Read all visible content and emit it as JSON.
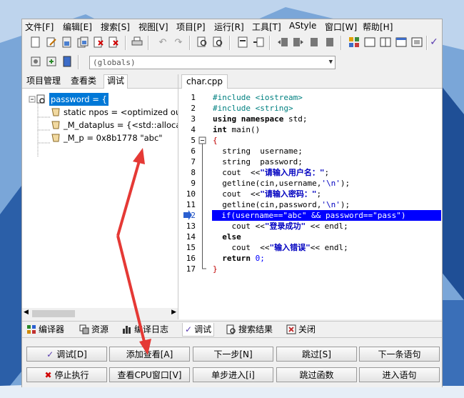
{
  "menubar": [
    "文件[F]",
    "编辑[E]",
    "搜索[S]",
    "视图[V]",
    "项目[P]",
    "运行[R]",
    "工具[T]",
    "AStyle",
    "窗口[W]",
    "帮助[H]"
  ],
  "globals_combo": "(globals)",
  "left_tabs": [
    "项目管理",
    "查看类",
    "调试"
  ],
  "watch_tree": [
    "password = {",
    "static npos = <optimized out",
    "_M_dataplus = {<std::allocat",
    "_M_p = 0x8b1778 \"abc\""
  ],
  "editor_tab": "char.cpp",
  "line_numbers": [
    "1",
    "2",
    "3",
    "4",
    "5",
    "6",
    "7",
    "8",
    "9",
    "10",
    "11",
    "12",
    "13",
    "14",
    "15",
    "16",
    "17"
  ],
  "code": {
    "l1a": "#include ",
    "l1b": "<iostream>",
    "l2a": "#include ",
    "l2b": "<string>",
    "l3a": "using namespace",
    "l3b": " std;",
    "l4a": "int",
    "l4b": " main()",
    "l5": "{",
    "l6": "  string  username;",
    "l7": "  string  password;",
    "l8a": "  cout  <<",
    "l8b": "\"请输入用户名：\"",
    "l8c": ";",
    "l9a": "  getline(cin,username,",
    "l9b": "'\\n'",
    "l9c": ");",
    "l10a": "  cout  <<",
    "l10b": "\"请输入密码：\"",
    "l10c": ";",
    "l11a": "  getline(cin,password,",
    "l11b": "'\\n'",
    "l11c": ");",
    "l12": "  if(username==\"abc\" && password==\"pass\")",
    "l13a": "    cout <<",
    "l13b": "\"登录成功\"",
    "l13c": " << endl;",
    "l14": "  else",
    "l15a": "    cout  <<",
    "l15b": "\"输入错误\"",
    "l15c": "<< endl;",
    "l16a": "  return",
    "l16b": " 0;",
    "l17": "}"
  },
  "bottom_tabs": [
    "编译器",
    "资源",
    "编译日志",
    "调试",
    "搜索结果",
    "关闭"
  ],
  "debug_buttons": {
    "debug": "调试[D]",
    "add_watch": "添加查看[A]",
    "next_step": "下一步[N]",
    "skip": "跳过[S]",
    "next_statement": "下一条语句",
    "stop": "停止执行",
    "cpu_window": "查看CPU窗口[V]",
    "step_into": "单步进入[i]",
    "skip_function": "跳过函数",
    "enter_statement": "进入语句"
  },
  "colors": {
    "highlight": "#0000ff",
    "arrow": "#e53935"
  }
}
